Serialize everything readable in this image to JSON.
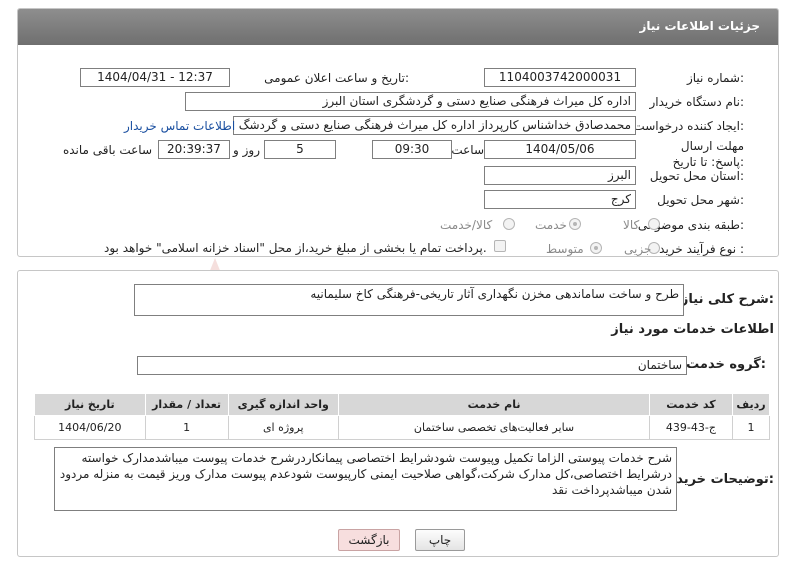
{
  "header": {
    "title": "جزئیات اطلاعات نیاز"
  },
  "form": {
    "need_number_label": "شماره نیاز:",
    "need_number": "1104003742000031",
    "announce_label": "تاریخ و ساعت اعلان عمومی:",
    "announce_value": "1404/04/31 - 12:37",
    "buyer_org_label": "نام دستگاه خریدار:",
    "buyer_org": "اداره کل میراث فرهنگی  صنایع دستی و گردشگری استان البرز",
    "requester_label": "ایجاد کننده درخواست:",
    "requester": "محمدصادق خداشناس  کارپرداز اداره کل میراث فرهنگی  صنایع دستی و گردشگ",
    "contact_link": "اطلاعات تماس خریدار",
    "deadline_label": "مهلت ارسال پاسخ: تا تاریخ:",
    "deadline_date": "1404/05/06",
    "time_label": "ساعت",
    "deadline_time": "09:30",
    "days_value": "5",
    "days_label": "روز و",
    "remaining_time": "20:39:37",
    "remaining_label": "ساعت باقی مانده",
    "province_label": "استان محل تحویل:",
    "province": "البرز",
    "city_label": "شهر محل تحویل:",
    "city": "کرج",
    "category_label": "طبقه بندی موضوعی:",
    "category_options": [
      "کالا",
      "خدمت",
      "کالا/خدمت"
    ],
    "process_label": "نوع فرآیند خرید :",
    "process_options": [
      "جزیی",
      "متوسط"
    ],
    "payment_note": "پرداخت تمام یا بخشی از مبلغ خرید،از محل \"اسناد خزانه اسلامی\" خواهد بود."
  },
  "details": {
    "summary_label": "شرح کلی نیاز:",
    "summary": "طرح و ساخت ساماندهی مخزن نگهداری آثار تاریخی-فرهنگی کاخ سلیمانیه",
    "services_title": "اطلاعات خدمات مورد نیاز",
    "service_group_label": "گروه خدمت:",
    "service_group": "ساختمان",
    "table": {
      "headers": [
        "ردیف",
        "کد خدمت",
        "نام خدمت",
        "واحد اندازه گیری",
        "تعداد / مقدار",
        "تاریخ نیاز"
      ],
      "rows": [
        [
          "1",
          "ج-43-439",
          "سایر فعالیت‌های تخصصی ساختمان",
          "پروژه ای",
          "1",
          "1404/06/20"
        ]
      ]
    },
    "buyer_notes_label": "توضیحات خریدار:",
    "buyer_notes": "شرح خدمات پیوستی الزاما تکمیل وپیوست شودشرایط اختصاصی پیمانکاردرشرح خدمات پیوست میباشدمدارک خواسته درشرایط اختصاصی،کل مدارک شرکت،گواهی صلاحیت ایمنی کارپیوست شودعدم پیوست مدارک وریز قیمت به منزله مردود شدن میباشدپرداخت نقد"
  },
  "buttons": {
    "print": "چاپ",
    "back": "بازگشت"
  },
  "watermark": {
    "text": "AriaTender.neT"
  }
}
